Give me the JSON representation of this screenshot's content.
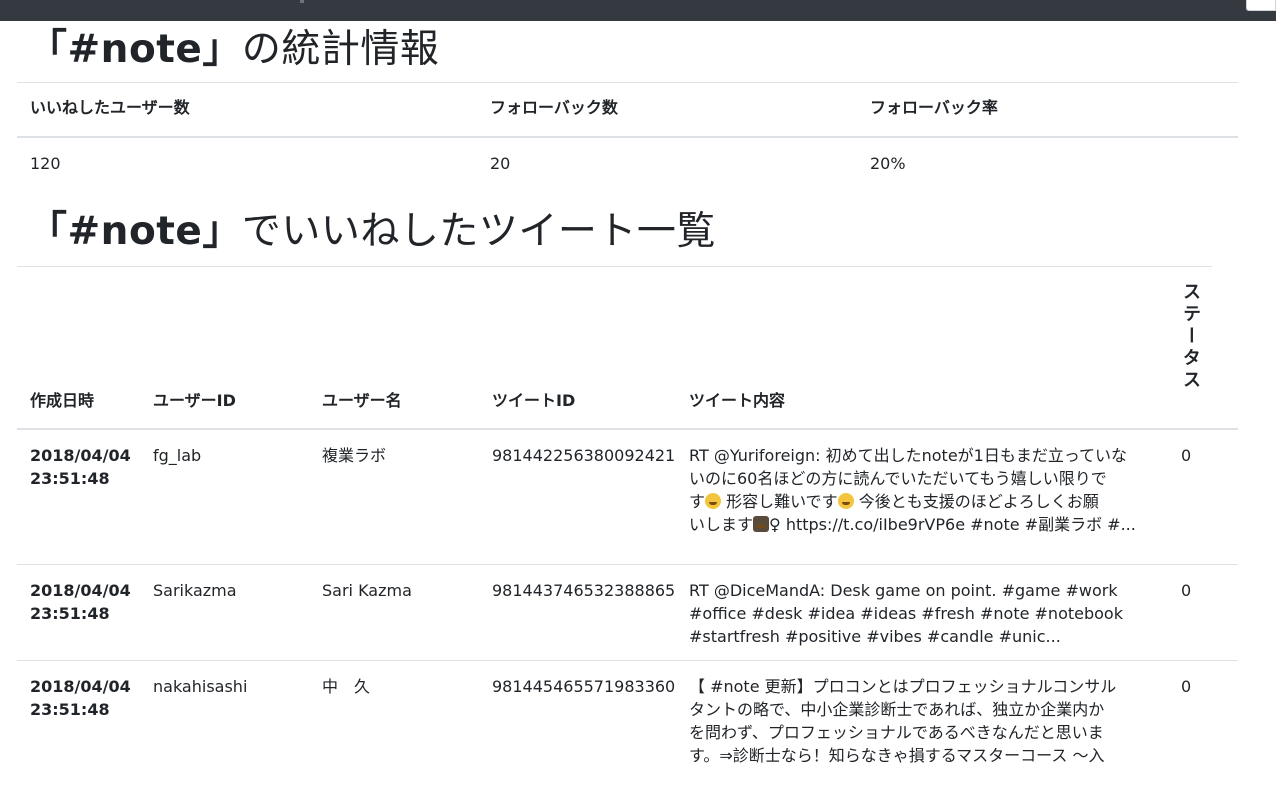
{
  "page": {
    "stats_title_tag": "「#note」",
    "stats_title_suffix": "の統計情報",
    "list_title_tag": "「#note」",
    "list_title_suffix": "でいいねしたツイート一覧"
  },
  "stats": {
    "headers": [
      "いいねしたユーザー数",
      "フォローバック数",
      "フォローバック率"
    ],
    "values": [
      "120",
      "20",
      "20%"
    ]
  },
  "tweets": {
    "headers": {
      "created": "作成日時",
      "user_id": "ユーザーID",
      "user_name": "ユーザー名",
      "tweet_id": "ツイートID",
      "content": "ツイート内容",
      "status": "ステータス"
    },
    "rows": [
      {
        "date": "2018/04/04",
        "time": "23:51:48",
        "user_id": "fg_lab",
        "user_name": "複業ラボ",
        "tweet_id": "981442256380092421",
        "content_1": "RT @Yuriforeign: 初めて出したnoteが1日もまだ立っていな",
        "content_2": "いのに60名ほどの方に読んでいただいてもう嬉しい限りで",
        "content_3a": "す",
        "content_3b": " 形容し難いです",
        "content_3c": " 今後とも支援のほどよろしくお願",
        "content_4a": "いします",
        "content_4b": "♀ https://t.co/iIbe9rVP6e #note #副業ラボ #...",
        "status": "0"
      },
      {
        "date": "2018/04/04",
        "time": "23:51:48",
        "user_id": "Sarikazma",
        "user_name": "Sari Kazma",
        "tweet_id": "981443746532388865",
        "content_1": "RT @DiceMandA: Desk game on point. #game #work",
        "content_2": "#office #desk #idea #ideas #fresh #note #notebook",
        "content_3": "#startfresh #positive #vibes #candle #unic...",
        "status": "0"
      },
      {
        "date": "2018/04/04",
        "time": "23:51:48",
        "user_id": "nakahisashi",
        "user_name": "中　久",
        "tweet_id": "981445465571983360",
        "content_1": "【 #note 更新】プロコンとはプロフェッショナルコンサル",
        "content_2": "タントの略で、中小企業診断士であれば、独立か企業内か",
        "content_3": "を問わず、プロフェッショナルであるべきなんだと思いま",
        "content_4": "す。⇒診断士なら！知らなきゃ損するマスターコース ～入",
        "status": "0"
      }
    ]
  }
}
